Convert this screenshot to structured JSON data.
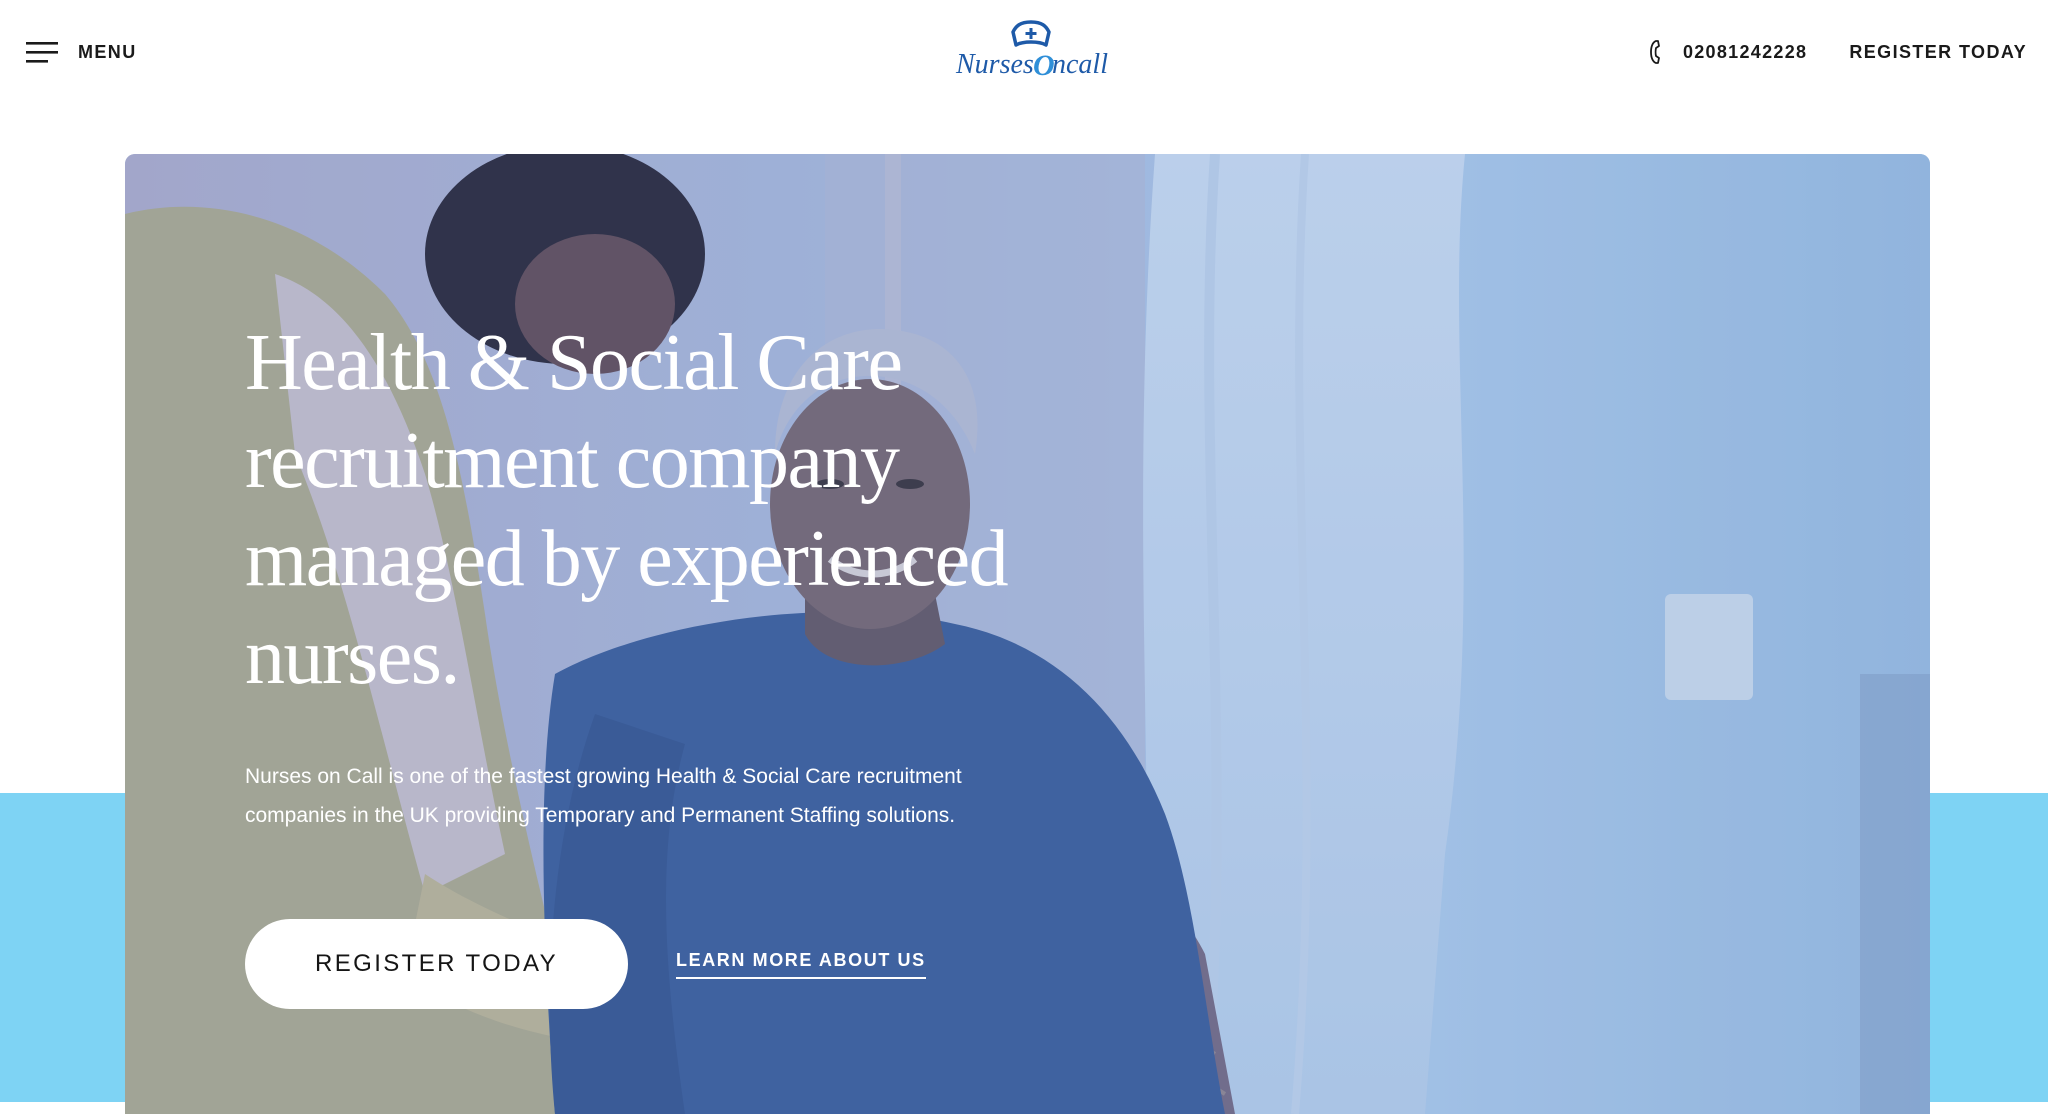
{
  "header": {
    "menu_label": "MENU",
    "logo_text": "Nurses on call",
    "logo_text_left": "Nurses",
    "logo_text_mid": "O",
    "logo_text_right": "ncall",
    "phone": "02081242228",
    "register_label": "REGISTER TODAY",
    "icons": [
      "menu-icon",
      "phone-icon"
    ]
  },
  "hero": {
    "title": "Health & Social Care recruitment company managed by experienced nurses.",
    "description": "Nurses on Call is one of the fastest growing Health & Social Care recruitment companies in the UK providing Temporary and Permanent Staffing solutions.",
    "primary_button": "REGISTER TODAY",
    "secondary_link": "LEARN MORE ABOUT US"
  },
  "colors": {
    "band": "#7ed3f4",
    "overlay": "#3d6fb8",
    "logo_blue": "#1e5aa8",
    "text_dark": "#1a1a1a"
  }
}
